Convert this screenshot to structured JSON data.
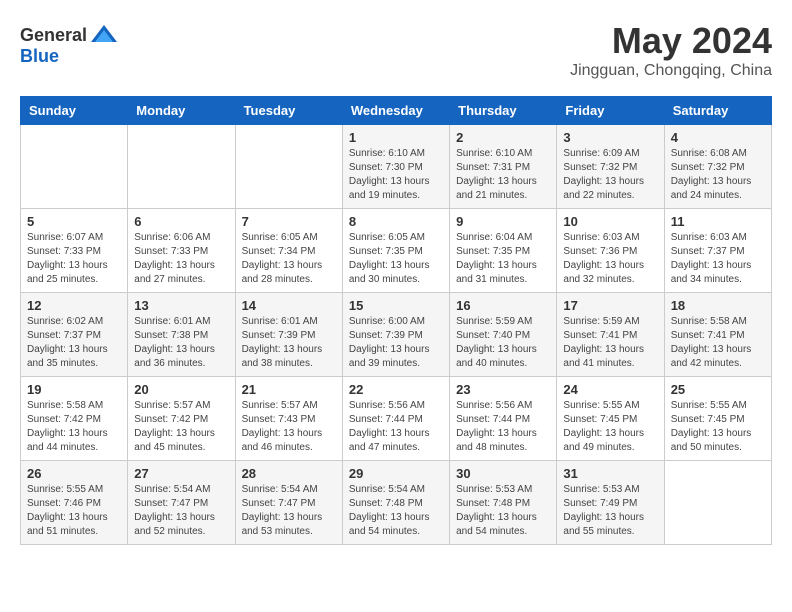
{
  "header": {
    "logo_general": "General",
    "logo_blue": "Blue",
    "month_year": "May 2024",
    "location": "Jingguan, Chongqing, China"
  },
  "weekdays": [
    "Sunday",
    "Monday",
    "Tuesday",
    "Wednesday",
    "Thursday",
    "Friday",
    "Saturday"
  ],
  "weeks": [
    [
      {
        "day": "",
        "content": ""
      },
      {
        "day": "",
        "content": ""
      },
      {
        "day": "",
        "content": ""
      },
      {
        "day": "1",
        "content": "Sunrise: 6:10 AM\nSunset: 7:30 PM\nDaylight: 13 hours\nand 19 minutes."
      },
      {
        "day": "2",
        "content": "Sunrise: 6:10 AM\nSunset: 7:31 PM\nDaylight: 13 hours\nand 21 minutes."
      },
      {
        "day": "3",
        "content": "Sunrise: 6:09 AM\nSunset: 7:32 PM\nDaylight: 13 hours\nand 22 minutes."
      },
      {
        "day": "4",
        "content": "Sunrise: 6:08 AM\nSunset: 7:32 PM\nDaylight: 13 hours\nand 24 minutes."
      }
    ],
    [
      {
        "day": "5",
        "content": "Sunrise: 6:07 AM\nSunset: 7:33 PM\nDaylight: 13 hours\nand 25 minutes."
      },
      {
        "day": "6",
        "content": "Sunrise: 6:06 AM\nSunset: 7:33 PM\nDaylight: 13 hours\nand 27 minutes."
      },
      {
        "day": "7",
        "content": "Sunrise: 6:05 AM\nSunset: 7:34 PM\nDaylight: 13 hours\nand 28 minutes."
      },
      {
        "day": "8",
        "content": "Sunrise: 6:05 AM\nSunset: 7:35 PM\nDaylight: 13 hours\nand 30 minutes."
      },
      {
        "day": "9",
        "content": "Sunrise: 6:04 AM\nSunset: 7:35 PM\nDaylight: 13 hours\nand 31 minutes."
      },
      {
        "day": "10",
        "content": "Sunrise: 6:03 AM\nSunset: 7:36 PM\nDaylight: 13 hours\nand 32 minutes."
      },
      {
        "day": "11",
        "content": "Sunrise: 6:03 AM\nSunset: 7:37 PM\nDaylight: 13 hours\nand 34 minutes."
      }
    ],
    [
      {
        "day": "12",
        "content": "Sunrise: 6:02 AM\nSunset: 7:37 PM\nDaylight: 13 hours\nand 35 minutes."
      },
      {
        "day": "13",
        "content": "Sunrise: 6:01 AM\nSunset: 7:38 PM\nDaylight: 13 hours\nand 36 minutes."
      },
      {
        "day": "14",
        "content": "Sunrise: 6:01 AM\nSunset: 7:39 PM\nDaylight: 13 hours\nand 38 minutes."
      },
      {
        "day": "15",
        "content": "Sunrise: 6:00 AM\nSunset: 7:39 PM\nDaylight: 13 hours\nand 39 minutes."
      },
      {
        "day": "16",
        "content": "Sunrise: 5:59 AM\nSunset: 7:40 PM\nDaylight: 13 hours\nand 40 minutes."
      },
      {
        "day": "17",
        "content": "Sunrise: 5:59 AM\nSunset: 7:41 PM\nDaylight: 13 hours\nand 41 minutes."
      },
      {
        "day": "18",
        "content": "Sunrise: 5:58 AM\nSunset: 7:41 PM\nDaylight: 13 hours\nand 42 minutes."
      }
    ],
    [
      {
        "day": "19",
        "content": "Sunrise: 5:58 AM\nSunset: 7:42 PM\nDaylight: 13 hours\nand 44 minutes."
      },
      {
        "day": "20",
        "content": "Sunrise: 5:57 AM\nSunset: 7:42 PM\nDaylight: 13 hours\nand 45 minutes."
      },
      {
        "day": "21",
        "content": "Sunrise: 5:57 AM\nSunset: 7:43 PM\nDaylight: 13 hours\nand 46 minutes."
      },
      {
        "day": "22",
        "content": "Sunrise: 5:56 AM\nSunset: 7:44 PM\nDaylight: 13 hours\nand 47 minutes."
      },
      {
        "day": "23",
        "content": "Sunrise: 5:56 AM\nSunset: 7:44 PM\nDaylight: 13 hours\nand 48 minutes."
      },
      {
        "day": "24",
        "content": "Sunrise: 5:55 AM\nSunset: 7:45 PM\nDaylight: 13 hours\nand 49 minutes."
      },
      {
        "day": "25",
        "content": "Sunrise: 5:55 AM\nSunset: 7:45 PM\nDaylight: 13 hours\nand 50 minutes."
      }
    ],
    [
      {
        "day": "26",
        "content": "Sunrise: 5:55 AM\nSunset: 7:46 PM\nDaylight: 13 hours\nand 51 minutes."
      },
      {
        "day": "27",
        "content": "Sunrise: 5:54 AM\nSunset: 7:47 PM\nDaylight: 13 hours\nand 52 minutes."
      },
      {
        "day": "28",
        "content": "Sunrise: 5:54 AM\nSunset: 7:47 PM\nDaylight: 13 hours\nand 53 minutes."
      },
      {
        "day": "29",
        "content": "Sunrise: 5:54 AM\nSunset: 7:48 PM\nDaylight: 13 hours\nand 54 minutes."
      },
      {
        "day": "30",
        "content": "Sunrise: 5:53 AM\nSunset: 7:48 PM\nDaylight: 13 hours\nand 54 minutes."
      },
      {
        "day": "31",
        "content": "Sunrise: 5:53 AM\nSunset: 7:49 PM\nDaylight: 13 hours\nand 55 minutes."
      },
      {
        "day": "",
        "content": ""
      }
    ]
  ]
}
